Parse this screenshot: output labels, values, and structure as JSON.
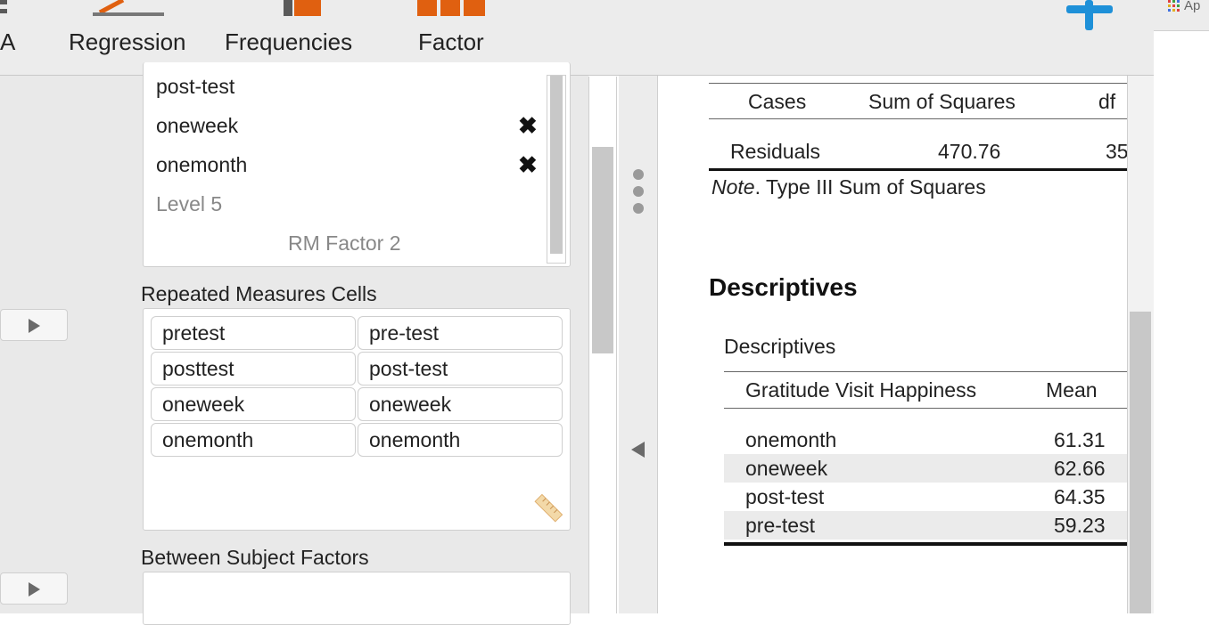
{
  "toolbar": {
    "items": [
      {
        "label": "A"
      },
      {
        "label": "Regression"
      },
      {
        "label": "Frequencies"
      },
      {
        "label": "Factor"
      }
    ],
    "add_icon": "plus-icon",
    "accent": "#1e90d8",
    "icon_orange": "#e06010"
  },
  "app_strip": {
    "label": "Ap",
    "icon": "apps-grid-icon"
  },
  "rm_factor": {
    "levels": [
      "post-test",
      "oneweek",
      "onemonth",
      "Level 5"
    ],
    "removable": [
      false,
      true,
      true,
      false
    ],
    "footer": "RM Factor 2"
  },
  "cells_section": {
    "title": "Repeated Measures Cells",
    "rows": [
      [
        "pretest",
        "pre-test"
      ],
      [
        "posttest",
        "post-test"
      ],
      [
        "oneweek",
        "oneweek"
      ],
      [
        "onemonth",
        "onemonth"
      ]
    ]
  },
  "between_section": {
    "title": "Between Subject Factors"
  },
  "anova_table": {
    "headers": [
      "Cases",
      "Sum of Squares",
      "df"
    ],
    "row": {
      "label": "Residuals",
      "ss": "470.76",
      "df": "35"
    },
    "note_prefix": "Note",
    "note_text": ". Type III Sum of Squares"
  },
  "descriptives": {
    "heading": "Descriptives",
    "table_title": "Descriptives",
    "col_factor": "Gratitude Visit Happiness",
    "col_mean": "Mean",
    "rows": [
      {
        "label": "onemonth",
        "mean": "61.31"
      },
      {
        "label": "oneweek",
        "mean": "62.66"
      },
      {
        "label": "post-test",
        "mean": "64.35"
      },
      {
        "label": "pre-test",
        "mean": "59.23"
      }
    ]
  }
}
